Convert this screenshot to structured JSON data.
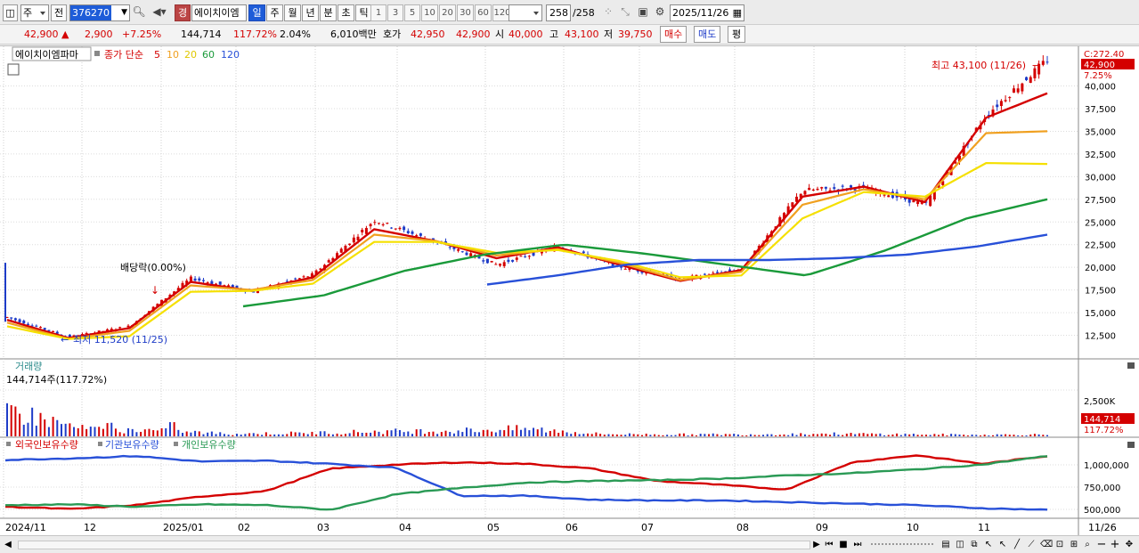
{
  "toolbar": {
    "market": "주",
    "prev": "전",
    "code": "376270",
    "stock_name": "에이치이엠",
    "tag": "경",
    "periods": [
      "일",
      "주",
      "월",
      "년",
      "분",
      "초",
      "틱"
    ],
    "active_period": "일",
    "intervals": [
      "1",
      "3",
      "5",
      "10",
      "20",
      "30",
      "60",
      "120"
    ],
    "count": "258",
    "count_total": "/258",
    "date": "2025/11/26"
  },
  "quote": {
    "price": "42,900",
    "arrow": "▲",
    "change": "2,900",
    "change_pct": "+7.25%",
    "volume": "144,714",
    "volume_ratio": "117.72%",
    "turnover": "2.04%",
    "amount": "6,010백만",
    "hoga_label": "호가",
    "ask": "42,950",
    "bid": "42,900",
    "open_label": "시",
    "open": "40,000",
    "high_label": "고",
    "high": "43,100",
    "low_label": "저",
    "low": "39,750",
    "buy_label": "매수",
    "sell_label": "매도",
    "even_label": "평"
  },
  "price_panel": {
    "title": "에이치이엠파마",
    "ma_label": "종가 단순",
    "ma_periods": [
      "5",
      "10",
      "20",
      "60",
      "120"
    ],
    "ma_colors": [
      "#d40000",
      "#f0a020",
      "#f5e000",
      "#1a9a3a",
      "#2850d8"
    ],
    "y_top_label": "C:272.40",
    "last_price": "42,900",
    "last_pct": "7.25%",
    "high_note": "최고 43,100 (11/26)",
    "low_note": "최저 11,520 (11/25)",
    "dividend_note": "배당락(0.00%)"
  },
  "volume_panel": {
    "title": "거래량",
    "value_label": "144,714주(117.72%)",
    "axis_label": "2,500K",
    "last_volume": "144,714",
    "last_ratio": "117.72%"
  },
  "holding_panel": {
    "series": [
      {
        "name": "외국인보유수량",
        "color": "#d40000"
      },
      {
        "name": "기관보유수량",
        "color": "#2850d8"
      },
      {
        "name": "개인보유수량",
        "color": "#2a9a55"
      }
    ],
    "axis_labels": [
      "1,000,000",
      "750,000",
      "500,000"
    ]
  },
  "chart_data": [
    {
      "type": "line",
      "title": "에이치이엠파마",
      "x": [
        "2024/11",
        "12",
        "2025/01",
        "02",
        "03",
        "04",
        "05",
        "06",
        "07",
        "08",
        "09",
        "10",
        "11",
        "11/26"
      ],
      "yticks": [
        12500,
        15000,
        17500,
        20000,
        22500,
        25000,
        27500,
        30000,
        32500,
        35000,
        37500,
        40000
      ],
      "ylim": [
        10000,
        42900
      ],
      "series": [
        {
          "name": "종가",
          "values": [
            14500,
            12300,
            13500,
            18800,
            17300,
            19200,
            25200,
            22800,
            20300,
            22300,
            20100,
            18700,
            19800,
            28500,
            28800,
            26900,
            36800,
            42900
          ]
        },
        {
          "name": "5",
          "values": [
            14200,
            12200,
            13300,
            18400,
            17400,
            18900,
            24200,
            22900,
            21000,
            22200,
            20300,
            18500,
            19700,
            27800,
            28900,
            27200,
            36500,
            39200
          ]
        },
        {
          "name": "10",
          "values": [
            13900,
            12100,
            13000,
            18000,
            17500,
            18600,
            23600,
            22900,
            21300,
            22000,
            20500,
            18600,
            19500,
            26900,
            28600,
            27500,
            34800,
            35000
          ]
        },
        {
          "name": "20",
          "values": [
            13500,
            12100,
            12400,
            17300,
            17400,
            18200,
            22800,
            22800,
            21600,
            21900,
            20700,
            18900,
            19100,
            25400,
            28300,
            27800,
            31500,
            31400
          ]
        },
        {
          "name": "60",
          "values": [
            15700,
            16900,
            19600,
            21400,
            22500,
            21500,
            20300,
            19100,
            21900,
            25400,
            27500
          ]
        },
        {
          "name": "120",
          "values": [
            18100,
            19100,
            20300,
            20800,
            20800,
            21000,
            21400,
            22300,
            23600
          ]
        }
      ],
      "annotations": [
        "최고 43,100 (11/26)",
        "최저 11,520 (11/25)",
        "배당락(0.00%)"
      ]
    },
    {
      "type": "bar",
      "title": "거래량",
      "yticks": [
        2500000
      ],
      "values": [
        2100000,
        600000,
        450000,
        200000,
        260000,
        390000,
        450000,
        600000,
        180000,
        150000,
        160000,
        210000,
        170000,
        120000,
        144714
      ]
    },
    {
      "type": "line",
      "title": "보유수량",
      "yticks": [
        500000,
        750000,
        1000000
      ],
      "series": [
        {
          "name": "외국인보유수량",
          "values": [
            500000,
            470000,
            520000,
            630000,
            700000,
            990000,
            1040000,
            1070000,
            1050000,
            990000,
            830000,
            780000,
            720000,
            1070000,
            1160000,
            1050000,
            1150000
          ]
        },
        {
          "name": "기관보유수량",
          "values": [
            1100000,
            1120000,
            1150000,
            1080000,
            1090000,
            1050000,
            1000000,
            640000,
            640000,
            590000,
            580000,
            580000,
            560000,
            540000,
            520000,
            480000,
            460000
          ]
        },
        {
          "name": "개인보유수량",
          "values": [
            520000,
            530000,
            500000,
            530000,
            520000,
            460000,
            660000,
            740000,
            810000,
            830000,
            840000,
            860000,
            900000,
            930000,
            980000,
            1040000,
            1150000
          ]
        }
      ]
    }
  ],
  "bottom_bar": {
    "last_label": "11/26"
  }
}
